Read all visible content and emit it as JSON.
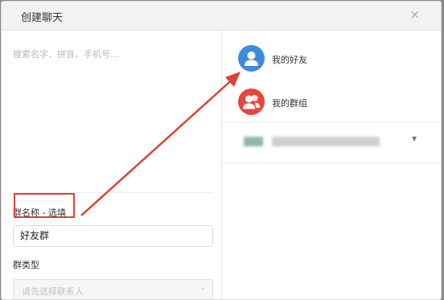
{
  "dialog": {
    "title": "创建聊天",
    "close_label": "×"
  },
  "left_panel": {
    "search_placeholder": "搜索名字、拼音、手机号...",
    "group_name_label": "群名称 - 选填",
    "group_name_value": "好友群",
    "group_type_label": "群类型",
    "group_type_placeholder": "请先选择联系人",
    "group_type_caret": "⌄"
  },
  "right_panel": {
    "items": [
      {
        "label": "我的好友",
        "icon": "person-icon",
        "color": "#3d8be0"
      },
      {
        "label": "我的群组",
        "icon": "group-icon",
        "color": "#e5473a"
      }
    ],
    "blurred_caret": "▼"
  },
  "colors": {
    "annotation_red": "#d9423a"
  }
}
